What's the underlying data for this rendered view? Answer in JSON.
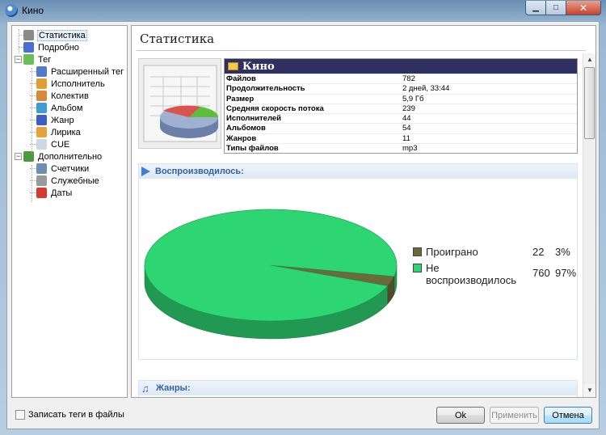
{
  "window": {
    "title": "Кино"
  },
  "tree": {
    "items": [
      {
        "label": "Статистика",
        "icon": "stats-gear-icon",
        "color": "#8a8a8a",
        "selected": true
      },
      {
        "label": "Подробно",
        "icon": "details-icon",
        "color": "#4a6fd0"
      },
      {
        "label": "Тег",
        "icon": "tag-icon",
        "color": "#6bbf59"
      },
      {
        "label": "Расширенный тег",
        "icon": "extended-tag-icon",
        "color": "#4f7bc8"
      },
      {
        "label": "Исполнитель",
        "icon": "artist-icon",
        "color": "#e0a030"
      },
      {
        "label": "Колектив",
        "icon": "band-icon",
        "color": "#d78a3a"
      },
      {
        "label": "Альбом",
        "icon": "album-icon",
        "color": "#3f9ad6"
      },
      {
        "label": "Жанр",
        "icon": "genre-note-icon",
        "color": "#3f5fc0"
      },
      {
        "label": "Лирика",
        "icon": "lyrics-icon",
        "color": "#e6a23c"
      },
      {
        "label": "CUE",
        "icon": "cue-file-icon",
        "color": "#cfd7e3"
      },
      {
        "label": "Дополнительно",
        "icon": "additional-icon",
        "color": "#4c9a3c"
      },
      {
        "label": "Счетчики",
        "icon": "counters-icon",
        "color": "#6f8fb0"
      },
      {
        "label": "Служебные",
        "icon": "service-icon",
        "color": "#9a9a9a"
      },
      {
        "label": "Даты",
        "icon": "calendar-icon",
        "color": "#d43a2f"
      }
    ]
  },
  "page": {
    "title": "Статистика"
  },
  "summary": {
    "name": "Кино",
    "rows": [
      {
        "key": "Файлов",
        "value": "782"
      },
      {
        "key": "Продолжительность",
        "value": "2 дней, 33:44"
      },
      {
        "key": "Размер",
        "value": "5,9 Гб"
      },
      {
        "key": "Средняя скорость потока",
        "value": "239"
      },
      {
        "key": "Исполнителей",
        "value": "44"
      },
      {
        "key": "Альбомов",
        "value": "54"
      },
      {
        "key": "Жанров",
        "value": "11"
      },
      {
        "key": "Типы файлов",
        "value": "mp3"
      }
    ]
  },
  "played_section": {
    "title": "Воспроизводилось:"
  },
  "genres_section": {
    "title": "Жанры:"
  },
  "chart_data": {
    "type": "pie",
    "title": "",
    "slices": [
      {
        "label": "Проиграно",
        "value": 22,
        "percent": "3%",
        "color": "#6b6b3a"
      },
      {
        "label": "Не воспроизводилось",
        "label_lines": [
          "Не",
          "воспроизводилось"
        ],
        "value": 760,
        "percent": "97%",
        "color": "#2ed573"
      }
    ],
    "legend": "right"
  },
  "footer": {
    "write_tags_label": "Записать теги в файлы",
    "write_tags_checked": false,
    "ok_label": "Ok",
    "apply_label": "Применить",
    "cancel_label": "Отмена"
  },
  "colors": {
    "header_bg": "#2f2f60",
    "section_text": "#3061a8",
    "accent": "#2ed573"
  }
}
